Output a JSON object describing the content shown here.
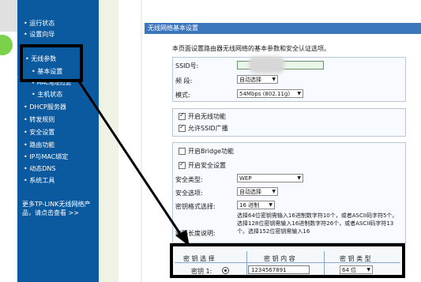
{
  "sidebar": {
    "items": [
      {
        "label": "• 运行状态"
      },
      {
        "label": "• 设置向导"
      },
      {
        "label": "• 无线参数"
      },
      {
        "label": "• 基本设置"
      },
      {
        "label": "• MAC地址过滤"
      },
      {
        "label": "• 主机状态"
      },
      {
        "label": "• DHCP服务器"
      },
      {
        "label": "• 转发规则"
      },
      {
        "label": "• 安全设置"
      },
      {
        "label": "• 路由功能"
      },
      {
        "label": "• IP与MAC绑定"
      },
      {
        "label": "• 动态DNS"
      },
      {
        "label": "• 系统工具"
      }
    ],
    "more_text": "更多TP-LINK无线网络产品，请点击查看 >>"
  },
  "page": {
    "title": "无线网络基本设置",
    "description": "本页面设置路由器无线网络的基本参数和安全认证选项。"
  },
  "form": {
    "ssid_label": "SSID号:",
    "band_label": "频  段:",
    "band_value": "自动选择",
    "mode_label": "模式:",
    "mode_value": "54Mbps (802.11g)",
    "enable_wireless_label": "开启无线功能",
    "ssid_broadcast_label": "允许SSID广播",
    "bridge_label": "开启Bridge功能",
    "security_label": "开启安全设置",
    "security_type_label": "安全类型:",
    "security_type_value": "WEP",
    "security_option_label": "安全选项:",
    "security_option_value": "自动选择",
    "key_format_label": "密钥格式选择:",
    "key_format_value": "16 进制",
    "key_length_label": "密码长度说明:",
    "key_length_desc": "选择64位密钥需输入16进制数字符10个，或者ASCII码字符5个。选择128位密钥需输入16进制数字符26个，或者ASCII码字符13个。选择152位密钥需输入16"
  },
  "key_table": {
    "headers": [
      "密 钥 选 择",
      "密 钥 内 容",
      "密 钥 类 型"
    ],
    "row_label": "密钥 1:",
    "key_value": "1234567891",
    "key_type": "64 位"
  },
  "colors": {
    "sidebar": "#0b5aa0",
    "title_bar": "#3c76bd",
    "panel_bg": "#f7fbff",
    "annotation": "#000000"
  }
}
